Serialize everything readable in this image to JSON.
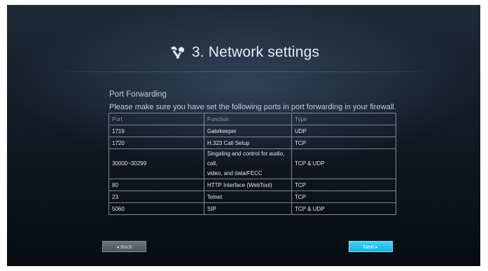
{
  "header": {
    "title": "3. Network settings",
    "icon": "tools-icon"
  },
  "section": {
    "title": "Port Forwarding",
    "note": "Please make sure you have set the following ports in port forwarding in your firewall."
  },
  "table": {
    "headers": {
      "port": "Port",
      "function": "Function",
      "type": "Type"
    },
    "rows": [
      {
        "port": "1719",
        "function": "Gatekeeper",
        "type": "UDP"
      },
      {
        "port": "1720",
        "function": "H.323 Call Setup",
        "type": "TCP"
      },
      {
        "port": "30000~30299",
        "function_line1": "Singaling and control for audio, call,",
        "function_line2": "video, and data/FECC",
        "type": "TCP & UDP"
      },
      {
        "port": "80",
        "function": "HTTP Interface (WebTool)",
        "type": "TCP"
      },
      {
        "port": "23",
        "function": "Telnet",
        "type": "TCP"
      },
      {
        "port": "5060",
        "function": "SIP",
        "type": "TCP & UDP"
      }
    ]
  },
  "buttons": {
    "back": "◂ Back",
    "next": "Next ▸"
  },
  "colors": {
    "accent": "#1fbdea",
    "background": "#121a25"
  }
}
